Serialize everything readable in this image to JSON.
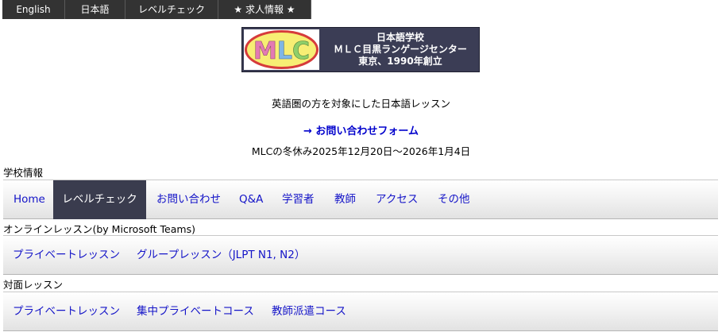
{
  "topbar": {
    "items": [
      {
        "label": "English"
      },
      {
        "label": "日本語"
      },
      {
        "label": "レベルチェック"
      },
      {
        "label": "★ 求人情報 ★"
      }
    ]
  },
  "logo": {
    "badge_text": "MLC",
    "lines": [
      "日本語学校",
      "ＭＬＣ目黒ランゲージセンター",
      "東京、1990年創立"
    ]
  },
  "header": {
    "subtitle": "英語圏の方を対象にした日本語レッスン",
    "contact_link": "→ お問い合わせフォーム",
    "holiday_notice": "MLCの冬休み2025年12月20日～2026年1月4日"
  },
  "sections": {
    "school_info": {
      "label": "学校情報",
      "items": [
        "Home",
        "レベルチェック",
        "お問い合わせ",
        "Q&A",
        "学習者",
        "教師",
        "アクセス",
        "その他"
      ],
      "active_index": 1
    },
    "online": {
      "label": "オンラインレッスン(by Microsoft Teams)",
      "items": [
        "プライベートレッスン",
        "グループレッスン（JLPT N1, N2）"
      ]
    },
    "in_person": {
      "label": "対面レッスン",
      "items": [
        "プライベートレッスン",
        "集中プライベートコース",
        "教師派遣コース"
      ]
    }
  },
  "colors": {
    "topbar_bg": "#333333",
    "active_tab_bg": "#3a3c4e",
    "link": "#1414c8",
    "logo_bg": "#3b3d55"
  }
}
